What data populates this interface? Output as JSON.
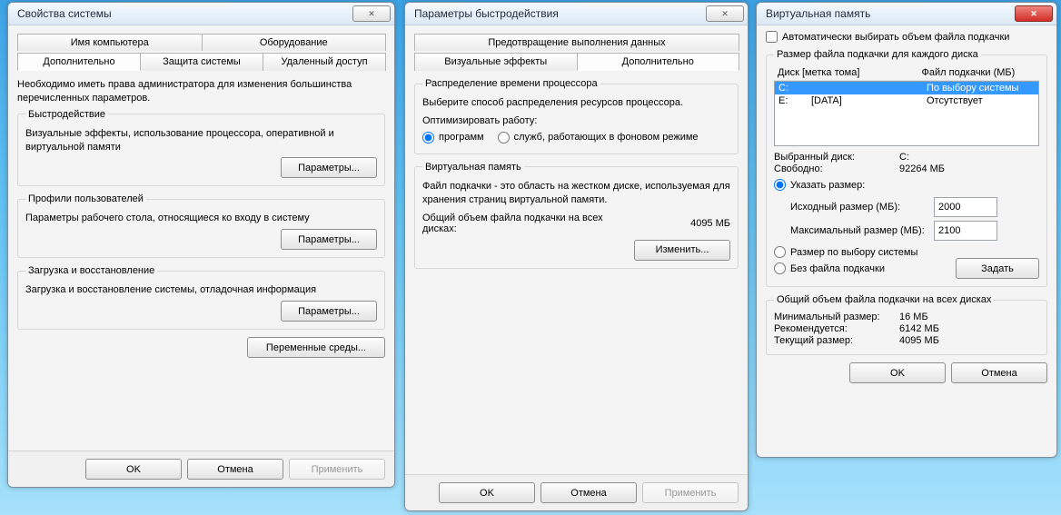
{
  "w1": {
    "title": "Свойства системы",
    "tabs_row1": [
      "Имя компьютера",
      "Оборудование"
    ],
    "tabs_row2": [
      "Дополнительно",
      "Защита системы",
      "Удаленный доступ"
    ],
    "active_tab": "Дополнительно",
    "intro": "Необходимо иметь права администратора для изменения большинства перечисленных параметров.",
    "grp1_title": "Быстродействие",
    "grp1_desc": "Визуальные эффекты, использование процессора, оперативной и виртуальной памяти",
    "grp1_btn": "Параметры...",
    "grp2_title": "Профили пользователей",
    "grp2_desc": "Параметры рабочего стола, относящиеся ко входу в систему",
    "grp2_btn": "Параметры...",
    "grp3_title": "Загрузка и восстановление",
    "grp3_desc": "Загрузка и восстановление системы, отладочная информация",
    "grp3_btn": "Параметры...",
    "env_btn": "Переменные среды...",
    "ok": "OK",
    "cancel": "Отмена",
    "apply": "Применить"
  },
  "w2": {
    "title": "Параметры быстродействия",
    "tabs_row1": [
      "Предотвращение выполнения данных"
    ],
    "tabs_row2": [
      "Визуальные эффекты",
      "Дополнительно"
    ],
    "active_tab": "Дополнительно",
    "grp1_title": "Распределение времени процессора",
    "grp1_desc": "Выберите способ распределения ресурсов процессора.",
    "opt_label": "Оптимизировать работу:",
    "opt_a": "программ",
    "opt_b": "служб, работающих в фоновом режиме",
    "grp2_title": "Виртуальная память",
    "grp2_desc": "Файл подкачки - это область на жестком диске, используемая для хранения страниц виртуальной памяти.",
    "total_label": "Общий объем файла подкачки на всех дисках:",
    "total_value": "4095 МБ",
    "change_btn": "Изменить...",
    "ok": "OK",
    "cancel": "Отмена",
    "apply": "Применить"
  },
  "w3": {
    "title": "Виртуальная память",
    "auto_check": "Автоматически выбирать объем файла подкачки",
    "size_title": "Размер файла подкачки для каждого диска",
    "col1": "Диск [метка тома]",
    "col2": "Файл подкачки (МБ)",
    "rows": [
      {
        "drive": "C:",
        "label": "",
        "pf": "По выбору системы"
      },
      {
        "drive": "E:",
        "label": "[DATA]",
        "pf": "Отсутствует"
      }
    ],
    "selected_label": "Выбранный диск:",
    "selected_value": "C:",
    "free_label": "Свободно:",
    "free_value": "92264 МБ",
    "opt_custom": "Указать размер:",
    "initial_label": "Исходный размер (МБ):",
    "initial_value": "2000",
    "max_label": "Максимальный размер (МБ):",
    "max_value": "2100",
    "opt_system": "Размер по выбору системы",
    "opt_none": "Без файла подкачки",
    "set_btn": "Задать",
    "totals_title": "Общий объем файла подкачки на всех дисках",
    "min_label": "Минимальный размер:",
    "min_value": "16 МБ",
    "rec_label": "Рекомендуется:",
    "rec_value": "6142 МБ",
    "cur_label": "Текущий размер:",
    "cur_value": "4095 МБ",
    "ok": "OK",
    "cancel": "Отмена"
  }
}
